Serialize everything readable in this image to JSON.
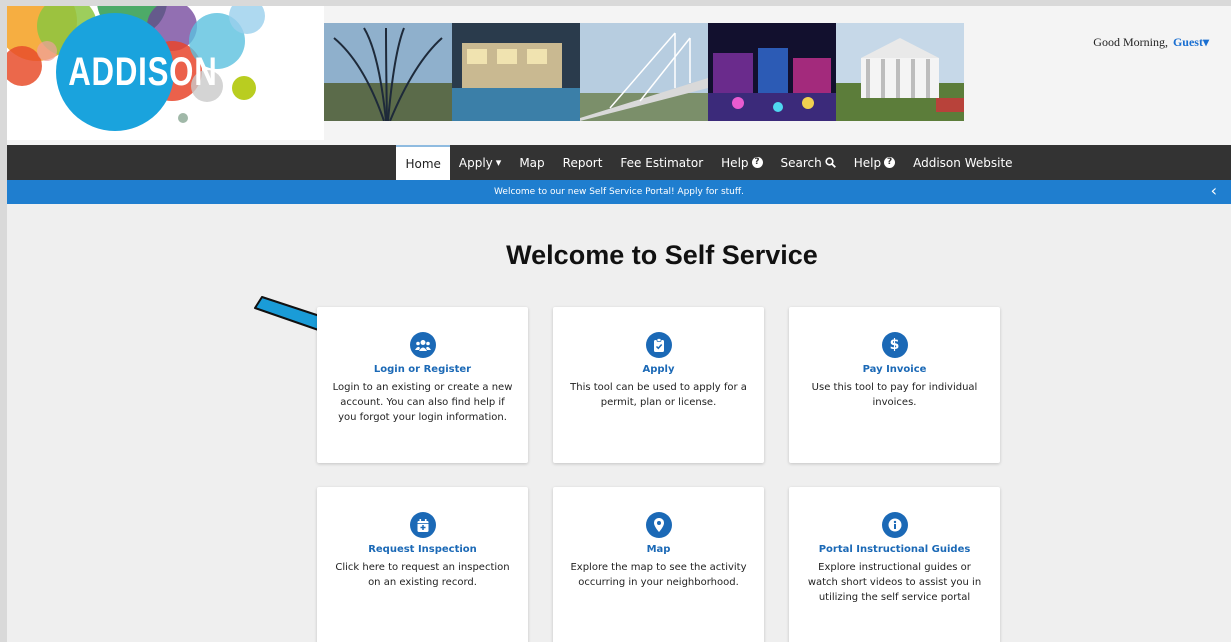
{
  "logo": {
    "text": "ADDISON"
  },
  "header": {
    "greeting": "Good Morning,",
    "user": "Guest"
  },
  "nav": {
    "items": [
      {
        "label": "Home",
        "active": true
      },
      {
        "label": "Apply",
        "icon": "caret-down-icon"
      },
      {
        "label": "Map"
      },
      {
        "label": "Report"
      },
      {
        "label": "Fee Estimator"
      },
      {
        "label": "Help",
        "icon": "question-circle-icon"
      },
      {
        "label": "Search",
        "icon": "search-icon"
      },
      {
        "label": "Help",
        "icon": "question-circle-icon"
      },
      {
        "label": "Addison Website"
      }
    ]
  },
  "announcement": {
    "text": "Welcome to our new Self Service Portal!  Apply for stuff."
  },
  "main": {
    "title": "Welcome to Self Service",
    "cards": [
      {
        "title": "Login or Register",
        "description": "Login to an existing or create a new account. You can also find help if you forgot your login information.",
        "icon": "users-icon"
      },
      {
        "title": "Apply",
        "description": "This tool can be used to apply for a permit, plan or license.",
        "icon": "clipboard-check-icon"
      },
      {
        "title": "Pay Invoice",
        "description": "Use this tool to pay for individual invoices.",
        "icon": "dollar-icon"
      },
      {
        "title": "Request Inspection",
        "description": "Click here to request an inspection on an existing record.",
        "icon": "calendar-plus-icon"
      },
      {
        "title": "Map",
        "description": "Explore the map to see the activity occurring in your neighborhood.",
        "icon": "map-marker-icon"
      },
      {
        "title": "Portal Instructional Guides",
        "description": "Explore instructional guides or watch short videos to assist you in utilizing the self service portal",
        "icon": "info-icon"
      }
    ]
  },
  "colors": {
    "nav_bg": "#333333",
    "announce_bg": "#1f7ecf",
    "accent": "#1b69b6",
    "arrow": "#1a9cd8"
  }
}
